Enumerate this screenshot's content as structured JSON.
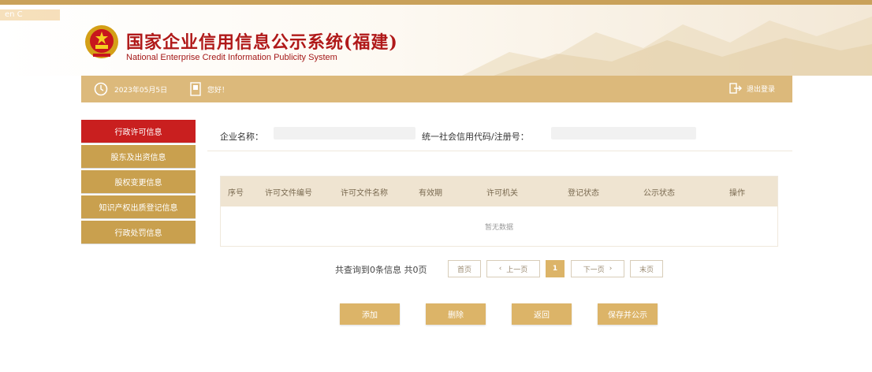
{
  "app": {
    "title_cn": "国家企业信用信息公示系统(福建)",
    "title_en": "National Enterprise Credit Information Publicity System",
    "watermark": "en C"
  },
  "toolbar": {
    "date": "2023年05月5日",
    "greeting": "您好！",
    "logout_label": "退出登录"
  },
  "sidebar": {
    "items": [
      {
        "label": "行政许可信息"
      },
      {
        "label": "股东及出资信息"
      },
      {
        "label": "股权变更信息"
      },
      {
        "label": "知识产权出质登记信息"
      },
      {
        "label": "行政处罚信息"
      }
    ]
  },
  "info": {
    "company_label": "企业名称：",
    "credit_code_label": "统一社会信用代码/注册号："
  },
  "table": {
    "columns": [
      "序号",
      "许可文件编号",
      "许可文件名称",
      "有效期",
      "许可机关",
      "登记状态",
      "公示状态",
      "操作"
    ],
    "empty_text": "暂无数据"
  },
  "pager": {
    "summary": "共查询到0条信息 共0页",
    "first": "首页",
    "prev": "上一页",
    "current": "1",
    "next": "下一页",
    "last": "末页"
  },
  "actions": {
    "add": "添加",
    "delete": "删除",
    "back": "返回",
    "save_publish": "保存并公示"
  },
  "colors": {
    "brand_red": "#b01919",
    "gold": "#dcb468",
    "sidebar_gold": "#c9a04e",
    "active_red": "#c91f1f"
  }
}
